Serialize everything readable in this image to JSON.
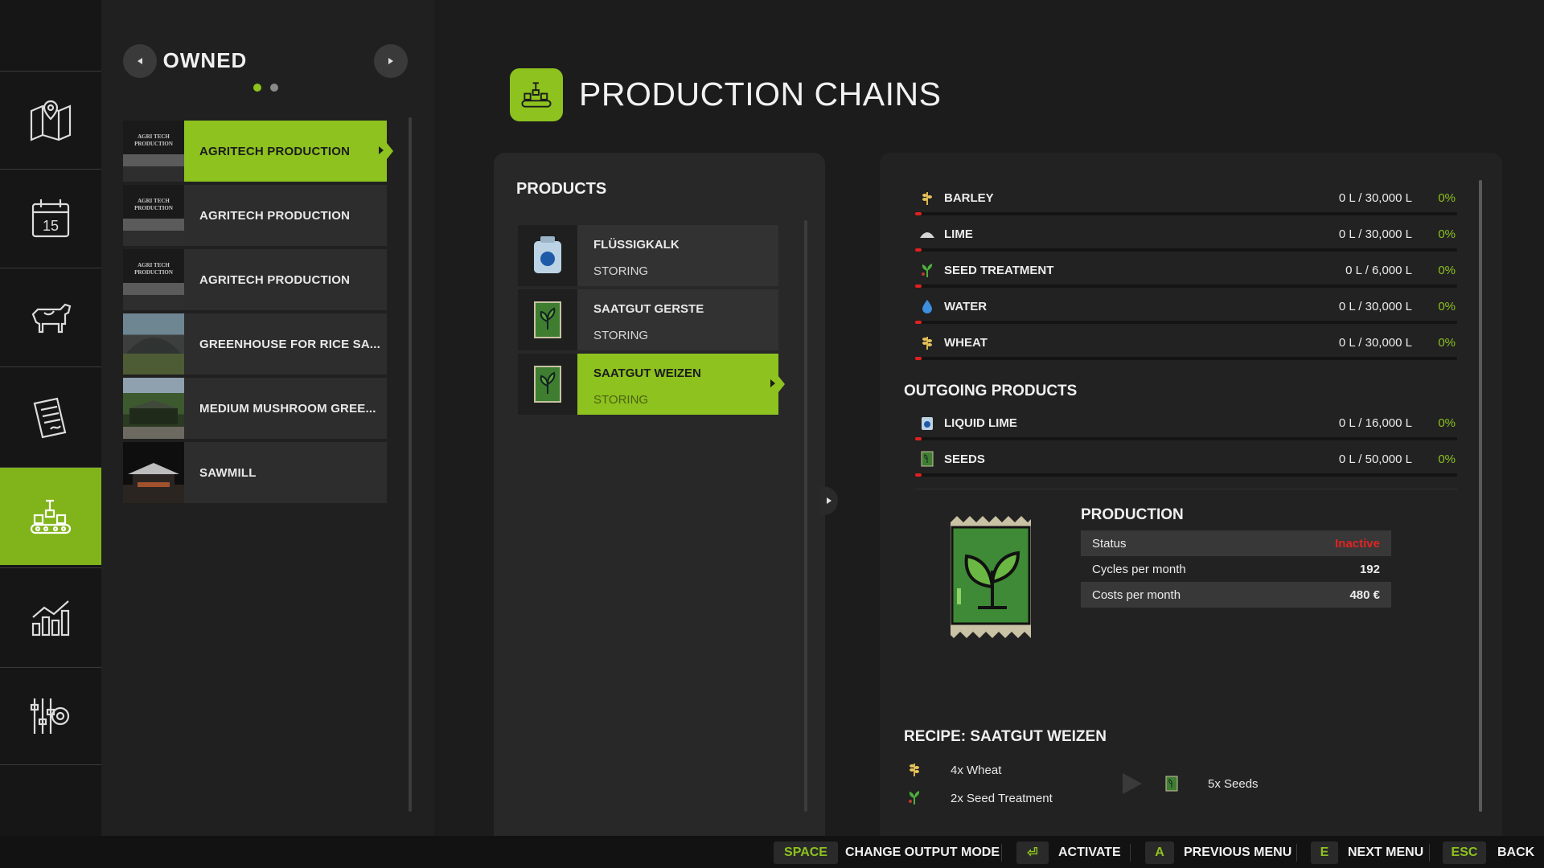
{
  "nav": {
    "items": [
      {
        "icon": "map-icon"
      },
      {
        "icon": "calendar-icon",
        "day": "15"
      },
      {
        "icon": "animals-icon"
      },
      {
        "icon": "contracts-icon"
      },
      {
        "icon": "production-icon",
        "active": true
      },
      {
        "icon": "statistics-icon"
      },
      {
        "icon": "settings-icon"
      }
    ]
  },
  "owned": {
    "title": "OWNED",
    "items": [
      {
        "label": "AGRITECH PRODUCTION",
        "thumb_text": "AGRI TECH PRODUCTION",
        "active": true
      },
      {
        "label": "AGRITECH PRODUCTION",
        "thumb_text": "AGRI TECH PRODUCTION"
      },
      {
        "label": "AGRITECH PRODUCTION",
        "thumb_text": "AGRI TECH PRODUCTION"
      },
      {
        "label": "GREENHOUSE FOR RICE SA..."
      },
      {
        "label": "MEDIUM MUSHROOM GREE..."
      },
      {
        "label": "SAWMILL"
      }
    ]
  },
  "header": {
    "title": "PRODUCTION CHAINS"
  },
  "products": {
    "title": "PRODUCTS",
    "items": [
      {
        "name": "FLÜSSIGKALK",
        "status": "STORING",
        "icon": "liquid-lime-icon"
      },
      {
        "name": "SAATGUT GERSTE",
        "status": "STORING",
        "icon": "seeds-icon"
      },
      {
        "name": "SAATGUT WEIZEN",
        "status": "STORING",
        "icon": "seeds-icon",
        "active": true
      }
    ]
  },
  "inputs": [
    {
      "name": "BARLEY",
      "amount": "0 L / 30,000 L",
      "percent": "0%",
      "icon": "barley-icon"
    },
    {
      "name": "LIME",
      "amount": "0 L / 30,000 L",
      "percent": "0%",
      "icon": "lime-icon"
    },
    {
      "name": "SEED TREATMENT",
      "amount": "0 L / 6,000 L",
      "percent": "0%",
      "icon": "seed-treatment-icon"
    },
    {
      "name": "WATER",
      "amount": "0 L / 30,000 L",
      "percent": "0%",
      "icon": "water-icon"
    },
    {
      "name": "WHEAT",
      "amount": "0 L / 30,000 L",
      "percent": "0%",
      "icon": "wheat-icon"
    }
  ],
  "outgoing": {
    "title": "OUTGOING PRODUCTS",
    "items": [
      {
        "name": "LIQUID LIME",
        "amount": "0 L / 16,000 L",
        "percent": "0%",
        "icon": "liquid-lime-icon"
      },
      {
        "name": "SEEDS",
        "amount": "0 L / 50,000 L",
        "percent": "0%",
        "icon": "seeds-icon"
      }
    ]
  },
  "production": {
    "title": "PRODUCTION",
    "status_label": "Status",
    "status_value": "Inactive",
    "cycles_label": "Cycles per month",
    "cycles_value": "192",
    "costs_label": "Costs per month",
    "costs_value": "480 €"
  },
  "recipe": {
    "title": "RECIPE: SAATGUT WEIZEN",
    "inputs": [
      "4x Wheat",
      "2x Seed Treatment"
    ],
    "output": "5x Seeds"
  },
  "keybar": [
    {
      "key": "SPACE",
      "label": "CHANGE OUTPUT MODE"
    },
    {
      "key": "⏎",
      "label": "ACTIVATE"
    },
    {
      "key": "A",
      "label": "PREVIOUS MENU"
    },
    {
      "key": "E",
      "label": "NEXT MENU"
    },
    {
      "key": "ESC",
      "label": "BACK"
    }
  ],
  "colors": {
    "accent": "#8dc21f",
    "danger": "#e02424",
    "panel": "#222222",
    "background": "#1c1c1c"
  }
}
